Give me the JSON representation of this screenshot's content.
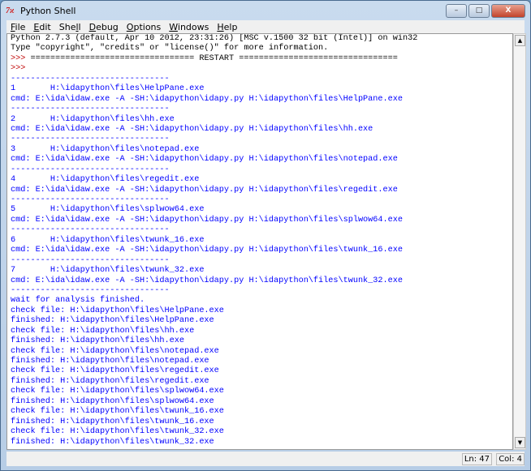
{
  "window": {
    "title": "Python Shell",
    "icon": "tk-feather-icon"
  },
  "controls": {
    "minimize": "–",
    "maximize": "□",
    "close": "X"
  },
  "menu": [
    {
      "u": "F",
      "rest": "ile"
    },
    {
      "u": "E",
      "rest": "dit"
    },
    {
      "pre": "She",
      "u": "l",
      "rest": "l"
    },
    {
      "u": "D",
      "rest": "ebug"
    },
    {
      "u": "O",
      "rest": "ptions"
    },
    {
      "u": "W",
      "rest": "indows"
    },
    {
      "u": "H",
      "rest": "elp"
    }
  ],
  "lines": [
    {
      "c": "black",
      "t": "Python 2.7.3 (default, Apr 10 2012, 23:31:26) [MSC v.1500 32 bit (Intel)] on win32"
    },
    {
      "c": "black",
      "t": "Type \"copyright\", \"credits\" or \"license()\" for more information."
    },
    {
      "c": "red",
      "p": ">>> ",
      "t": "================================= RESTART ================================"
    },
    {
      "c": "red",
      "p": ">>> ",
      "t": ""
    },
    {
      "c": "blue",
      "t": "--------------------------------"
    },
    {
      "c": "blue",
      "t": "1       H:\\idapython\\files\\HelpPane.exe"
    },
    {
      "c": "blue",
      "t": "cmd: E:\\ida\\idaw.exe -A -SH:\\idapython\\idapy.py H:\\idapython\\files\\HelpPane.exe"
    },
    {
      "c": "blue",
      "t": "--------------------------------"
    },
    {
      "c": "blue",
      "t": "2       H:\\idapython\\files\\hh.exe"
    },
    {
      "c": "blue",
      "t": "cmd: E:\\ida\\idaw.exe -A -SH:\\idapython\\idapy.py H:\\idapython\\files\\hh.exe"
    },
    {
      "c": "blue",
      "t": "--------------------------------"
    },
    {
      "c": "blue",
      "t": "3       H:\\idapython\\files\\notepad.exe"
    },
    {
      "c": "blue",
      "t": "cmd: E:\\ida\\idaw.exe -A -SH:\\idapython\\idapy.py H:\\idapython\\files\\notepad.exe"
    },
    {
      "c": "blue",
      "t": "--------------------------------"
    },
    {
      "c": "blue",
      "t": "4       H:\\idapython\\files\\regedit.exe"
    },
    {
      "c": "blue",
      "t": "cmd: E:\\ida\\idaw.exe -A -SH:\\idapython\\idapy.py H:\\idapython\\files\\regedit.exe"
    },
    {
      "c": "blue",
      "t": "--------------------------------"
    },
    {
      "c": "blue",
      "t": "5       H:\\idapython\\files\\splwow64.exe"
    },
    {
      "c": "blue",
      "t": "cmd: E:\\ida\\idaw.exe -A -SH:\\idapython\\idapy.py H:\\idapython\\files\\splwow64.exe"
    },
    {
      "c": "blue",
      "t": "--------------------------------"
    },
    {
      "c": "blue",
      "t": "6       H:\\idapython\\files\\twunk_16.exe"
    },
    {
      "c": "blue",
      "t": "cmd: E:\\ida\\idaw.exe -A -SH:\\idapython\\idapy.py H:\\idapython\\files\\twunk_16.exe"
    },
    {
      "c": "blue",
      "t": "--------------------------------"
    },
    {
      "c": "blue",
      "t": "7       H:\\idapython\\files\\twunk_32.exe"
    },
    {
      "c": "blue",
      "t": "cmd: E:\\ida\\idaw.exe -A -SH:\\idapython\\idapy.py H:\\idapython\\files\\twunk_32.exe"
    },
    {
      "c": "blue",
      "t": "--------------------------------"
    },
    {
      "c": "blue",
      "t": "wait for analysis finished."
    },
    {
      "c": "blue",
      "t": "check file: H:\\idapython\\files\\HelpPane.exe"
    },
    {
      "c": "blue",
      "t": "finished: H:\\idapython\\files\\HelpPane.exe"
    },
    {
      "c": "blue",
      "t": "check file: H:\\idapython\\files\\hh.exe"
    },
    {
      "c": "blue",
      "t": "finished: H:\\idapython\\files\\hh.exe"
    },
    {
      "c": "blue",
      "t": "check file: H:\\idapython\\files\\notepad.exe"
    },
    {
      "c": "blue",
      "t": "finished: H:\\idapython\\files\\notepad.exe"
    },
    {
      "c": "blue",
      "t": "check file: H:\\idapython\\files\\regedit.exe"
    },
    {
      "c": "blue",
      "t": "finished: H:\\idapython\\files\\regedit.exe"
    },
    {
      "c": "blue",
      "t": "check file: H:\\idapython\\files\\splwow64.exe"
    },
    {
      "c": "blue",
      "t": "finished: H:\\idapython\\files\\splwow64.exe"
    },
    {
      "c": "blue",
      "t": "check file: H:\\idapython\\files\\twunk_16.exe"
    },
    {
      "c": "blue",
      "t": "finished: H:\\idapython\\files\\twunk_16.exe"
    },
    {
      "c": "blue",
      "t": "check file: H:\\idapython\\files\\twunk_32.exe"
    },
    {
      "c": "blue",
      "t": "finished: H:\\idapython\\files\\twunk_32.exe"
    }
  ],
  "status": {
    "line": "Ln: 47",
    "col": "Col: 4"
  },
  "colors": {
    "output": "#0000ff",
    "prompt": "#c00000",
    "text": "#000000"
  }
}
